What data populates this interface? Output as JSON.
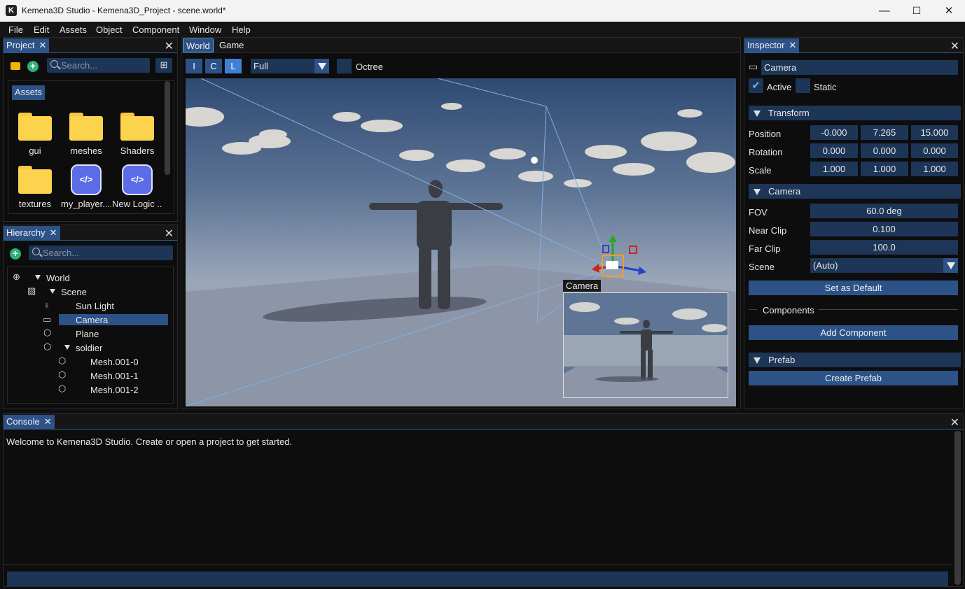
{
  "window": {
    "title": "Kemena3D Studio - Kemena3D_Project - scene.world*",
    "app_icon": "K",
    "minimize": "—",
    "maximize": "☐",
    "close": "✕"
  },
  "menu": [
    "File",
    "Edit",
    "Assets",
    "Object",
    "Component",
    "Window",
    "Help"
  ],
  "project": {
    "tab": "Project",
    "search_placeholder": "Search...",
    "breadcrumb": "Assets",
    "items": [
      {
        "label": "gui",
        "kind": "folder"
      },
      {
        "label": "meshes",
        "kind": "folder"
      },
      {
        "label": "Shaders",
        "kind": "folder"
      },
      {
        "label": "textures",
        "kind": "folder"
      },
      {
        "label": "my_player....",
        "kind": "script"
      },
      {
        "label": "New Logic ...",
        "kind": "script"
      }
    ]
  },
  "hierarchy": {
    "tab": "Hierarchy",
    "search_placeholder": "Search...",
    "nodes": [
      {
        "label": "World",
        "icon": "globe-icon"
      },
      {
        "label": "Scene",
        "icon": "image-icon"
      },
      {
        "label": "Sun Light",
        "icon": "bulb-icon"
      },
      {
        "label": "Camera",
        "icon": "camera-icon",
        "selected": true
      },
      {
        "label": "Plane",
        "icon": "cube-icon"
      },
      {
        "label": "soldier",
        "icon": "cube-icon"
      },
      {
        "label": "Mesh.001-0",
        "icon": "cube-icon"
      },
      {
        "label": "Mesh.001-1",
        "icon": "cube-icon"
      },
      {
        "label": "Mesh.001-2",
        "icon": "cube-icon"
      }
    ]
  },
  "viewport": {
    "tabs": [
      "World",
      "Game"
    ],
    "modes": [
      "I",
      "C",
      "L"
    ],
    "active_mode": "L",
    "render_mode": "Full",
    "octree_label": "Octree",
    "camera_label": "Camera"
  },
  "inspector": {
    "tab": "Inspector",
    "object_name": "Camera",
    "active_label": "Active",
    "active": true,
    "static_label": "Static",
    "static": false,
    "transform": {
      "title": "Transform",
      "position_label": "Position",
      "position": [
        "-0.000",
        "7.265",
        "15.000"
      ],
      "rotation_label": "Rotation",
      "rotation": [
        "0.000",
        "0.000",
        "0.000"
      ],
      "scale_label": "Scale",
      "scale": [
        "1.000",
        "1.000",
        "1.000"
      ]
    },
    "camera": {
      "title": "Camera",
      "fov_label": "FOV",
      "fov": "60.0 deg",
      "near_label": "Near Clip",
      "near": "0.100",
      "far_label": "Far Clip",
      "far": "100.0",
      "scene_label": "Scene",
      "scene": "(Auto)",
      "set_default": "Set as Default"
    },
    "components_label": "Components",
    "add_component": "Add Component",
    "prefab": {
      "title": "Prefab",
      "create": "Create Prefab"
    }
  },
  "console": {
    "tab": "Console",
    "message": "Welcome to Kemena3D Studio. Create or open a project to get started."
  },
  "colors": {
    "accent": "#2c5287",
    "field": "#1d3557",
    "panel": "#0d0d0d"
  }
}
